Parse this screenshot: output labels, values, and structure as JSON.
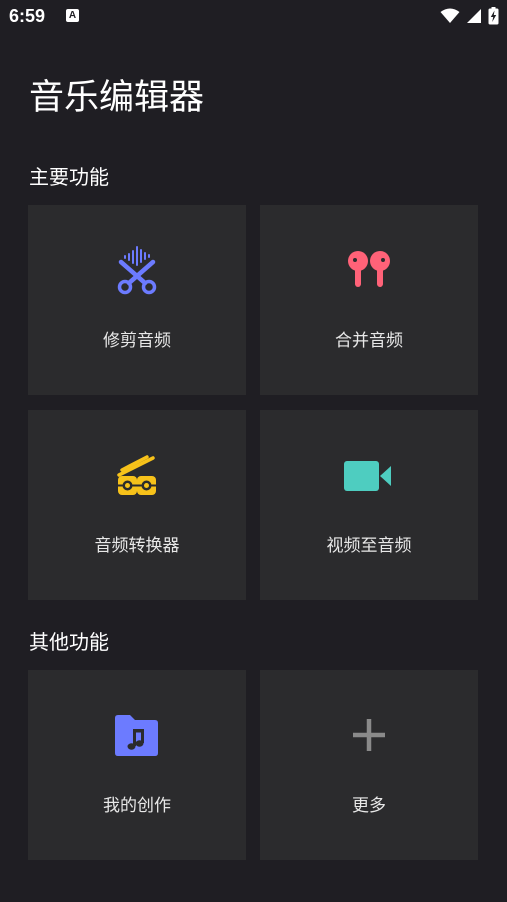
{
  "status_bar": {
    "time": "6:59",
    "notification_icon": "a-icon",
    "wifi_icon": "wifi-icon",
    "signal_icon": "cell-signal-icon",
    "battery_icon": "battery-charging-icon"
  },
  "app": {
    "title": "音乐编辑器"
  },
  "sections": {
    "main": {
      "title": "主要功能",
      "cards": [
        {
          "label": "修剪音频",
          "icon": "scissors-waveform-icon",
          "color": "#6c7bff"
        },
        {
          "label": "合并音频",
          "icon": "earbuds-icon",
          "color": "#ff6278"
        },
        {
          "label": "音频转换器",
          "icon": "reels-icon",
          "color": "#f7c21a"
        },
        {
          "label": "视频至音频",
          "icon": "video-camera-icon",
          "color": "#4ecdc0"
        }
      ]
    },
    "other": {
      "title": "其他功能",
      "cards": [
        {
          "label": "我的创作",
          "icon": "music-folder-icon",
          "color": "#6c7bff"
        },
        {
          "label": "更多",
          "icon": "plus-icon",
          "color": "#8a8a8a"
        }
      ]
    }
  },
  "colors": {
    "background": "#1f1e23",
    "card": "#2b2b2d"
  }
}
